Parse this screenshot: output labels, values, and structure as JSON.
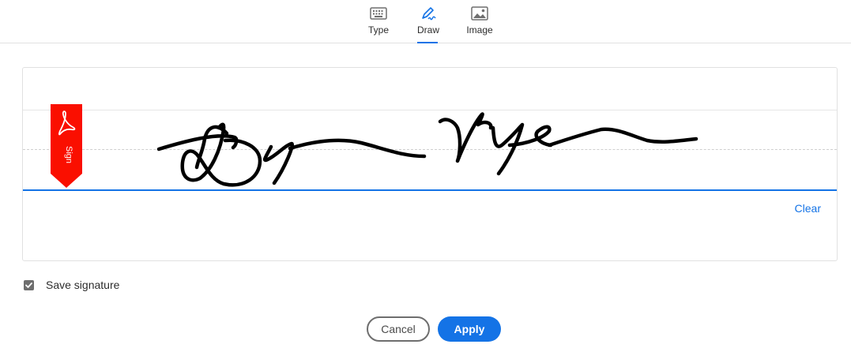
{
  "tabs": [
    {
      "label": "Type",
      "icon": "keyboard-icon",
      "active": false
    },
    {
      "label": "Draw",
      "icon": "pen-icon",
      "active": true
    },
    {
      "label": "Image",
      "icon": "image-icon",
      "active": false
    }
  ],
  "canvas": {
    "flag_label": "Sign",
    "clear_label": "Clear"
  },
  "save_signature": {
    "label": "Save signature",
    "checked": true
  },
  "buttons": {
    "cancel_label": "Cancel",
    "apply_label": "Apply"
  },
  "colors": {
    "accent": "#1473e6",
    "flag_red": "#fa0f00",
    "ink": "#000000"
  }
}
